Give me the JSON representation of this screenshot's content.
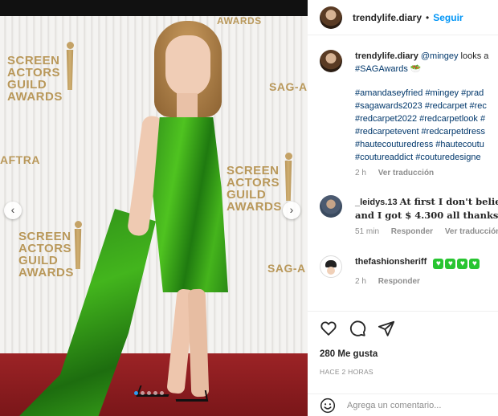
{
  "post_author": {
    "username": "trendylife.diary",
    "separator": "•",
    "follow_label": "Seguir"
  },
  "photo": {
    "backdrop_text": {
      "logo_screen": "SCREEN",
      "logo_actors": "ACTORS",
      "logo_guild": "GUILD",
      "logo_awards": "AWARDS",
      "sag": "SAG-A",
      "aftra": "AFTRA",
      "top_awards": "AWARDS"
    },
    "dots_count": 5,
    "active_dot": 0
  },
  "caption": {
    "username": "trendylife.diary",
    "mention": "@mingey",
    "text_after_mention": " looks a",
    "line2": "#SAGAwards 🥗",
    "hashtag_lines": [
      "#amandaseyfried #mingey #prad",
      "#sagawards2023 #redcarpet #rec",
      "#redcarpet2022 #redcarpetlook #",
      "#redcarpetevent #redcarpetdress",
      "#hautecouturedress #hautecoutu",
      "#coutureaddict #couturedesigne"
    ],
    "time": "2 h",
    "translate_label": "Ver traducción"
  },
  "comments": [
    {
      "username": "_leidys.13",
      "line1": "At first I don't believe",
      "line2": "and I got $ 4.300 all thanks To",
      "time": "51 min",
      "reply_label": "Responder",
      "translate_label": "Ver traducción"
    },
    {
      "username": "thefashionsheriff",
      "hearts": [
        "♥",
        "♥",
        "♥",
        "♥"
      ],
      "time": "2 h",
      "reply_label": "Responder"
    }
  ],
  "actions": {
    "likes_text": "280 Me gusta",
    "ago_text": "HACE 2 HORAS",
    "like_icon": "heart-outline-icon",
    "comment_icon": "speech-bubble-icon",
    "share_icon": "paper-plane-icon"
  },
  "add_comment": {
    "placeholder": "Agrega un comentario..."
  },
  "colors": {
    "link_blue": "#0095f6",
    "hashtag_blue": "#00376b",
    "muted_gray": "#8e8e8e",
    "dress_green": "#3aa41a",
    "carpet_red": "#8c1d20",
    "heart_green": "#28c531"
  }
}
